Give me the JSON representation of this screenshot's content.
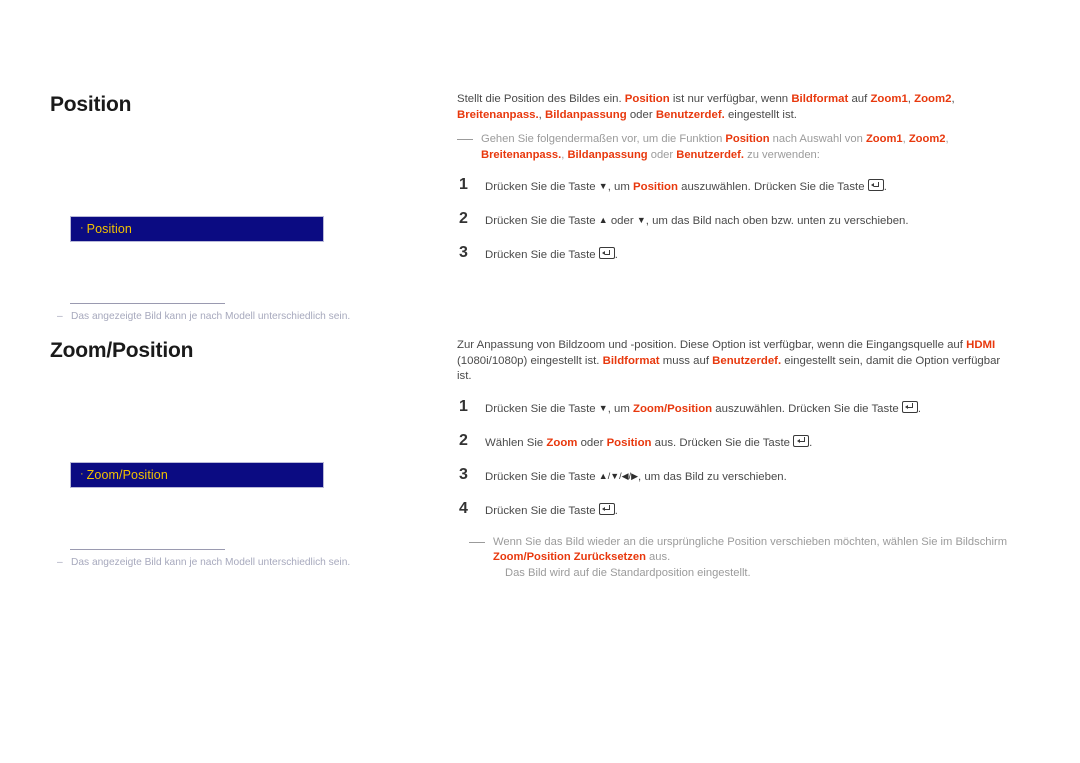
{
  "document": {
    "sections": [
      {
        "id": "position",
        "heading": "Position",
        "menu_item_label": "Position",
        "menu_item_bullet": "·",
        "footnote_dash": "–",
        "footnote": "Das angezeigte Bild kann je nach Modell unterschiedlich sein.",
        "intro": {
          "part1": "Stellt die Position des Bildes ein. ",
          "kw1": "Position",
          "part2": " ist nur verfügbar, wenn ",
          "kw2": "Bildformat",
          "part3": " auf ",
          "kw3": "Zoom1",
          "part4": ", ",
          "kw4": "Zoom2",
          "part5": ", ",
          "kw5": "Breitenanpass.",
          "part6": ", ",
          "kw6": "Bildanpassung",
          "part7": " oder ",
          "kw7": "Benutzerdef.",
          "part8": " eingestellt ist."
        },
        "note": {
          "part1": "Gehen Sie folgendermaßen vor, um die Funktion ",
          "kw1": "Position",
          "part2": " nach Auswahl von ",
          "kw2": "Zoom1",
          "part3": ", ",
          "kw3": "Zoom2",
          "part4": ", ",
          "kw4": "Breitenanpass.",
          "part5": ", ",
          "kw5": "Bildanpassung",
          "part6": " oder ",
          "kw6": "Benutzerdef.",
          "part7": " zu verwenden:"
        },
        "steps": [
          {
            "num": "1",
            "p1": "Drücken Sie die Taste ",
            "icon1": "down-arrow",
            "p2": ", um ",
            "kw1": "Position",
            "p3": " auszuwählen. Drücken Sie die Taste ",
            "icon2": "enter-key",
            "p4": "."
          },
          {
            "num": "2",
            "p1": "Drücken Sie die Taste ",
            "icon1": "up-arrow",
            "p2": " oder ",
            "icon2": "down-arrow",
            "p3": ", um das Bild nach oben bzw. unten zu verschieben."
          },
          {
            "num": "3",
            "p1": "Drücken Sie die Taste ",
            "icon1": "enter-key",
            "p2": "."
          }
        ]
      },
      {
        "id": "zoomposition",
        "heading": "Zoom/Position",
        "menu_item_label": "Zoom/Position",
        "menu_item_bullet": "·",
        "footnote_dash": "–",
        "footnote": "Das angezeigte Bild kann je nach Modell unterschiedlich sein.",
        "intro": {
          "part1": "Zur Anpassung von Bildzoom und -position. Diese Option ist verfügbar, wenn die Eingangsquelle auf ",
          "kw1": "HDMI",
          "part2": " (1080i/1080p) eingestellt ist. ",
          "kw2": "Bildformat",
          "part3": " muss auf ",
          "kw3": "Benutzerdef.",
          "part4": " eingestellt sein, damit die Option verfügbar ist."
        },
        "steps": [
          {
            "num": "1",
            "p1": "Drücken Sie die Taste ",
            "icon1": "down-arrow",
            "p2": ", um ",
            "kw1": "Zoom/Position",
            "p3": " auszuwählen. Drücken Sie die Taste ",
            "icon2": "enter-key",
            "p4": "."
          },
          {
            "num": "2",
            "p1": "Wählen Sie ",
            "kw1": "Zoom",
            "p2": " oder ",
            "kw2": "Position",
            "p3": " aus. Drücken Sie die Taste ",
            "icon2": "enter-key",
            "p4": "."
          },
          {
            "num": "3",
            "p1": "Drücken Sie die Taste ",
            "icons": "up/down/left/right-arrows",
            "p2": ", um das Bild zu verschieben."
          },
          {
            "num": "4",
            "p1": "Drücken Sie die Taste ",
            "icon1": "enter-key",
            "p2": "."
          }
        ],
        "note": {
          "part1": "Wenn Sie das Bild wieder an die ursprüngliche Position verschieben möchten, wählen Sie im Bildschirm ",
          "kw1": "Zoom/",
          "kw2": "Position Zurücksetzen",
          "part2": " aus.",
          "part3": "Das Bild wird auf die Standardposition eingestellt."
        }
      }
    ],
    "colors": {
      "accent": "#e8380d",
      "menu_box_bg": "#0b0b82",
      "menu_box_text": "#f2c200",
      "body_text": "#4a4a4a",
      "note_text": "#9b9b9b",
      "footnote_text": "#a7a9bd"
    }
  }
}
